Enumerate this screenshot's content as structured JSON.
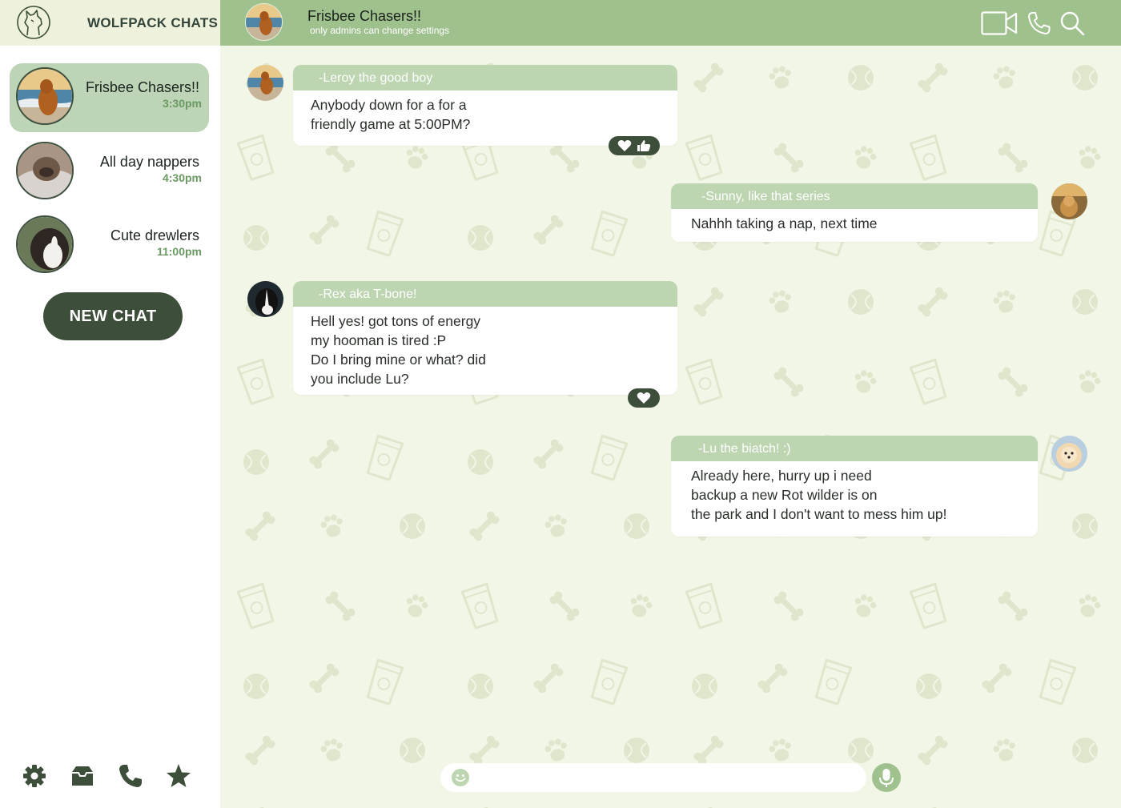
{
  "app": {
    "title": "WOLFPACK CHATS"
  },
  "chats": [
    {
      "name": "Frisbee Chasers!!",
      "time": "3:30pm",
      "active": true
    },
    {
      "name": "All day nappers",
      "time": "4:30pm",
      "active": false
    },
    {
      "name": "Cute drewlers",
      "time": "11:00pm",
      "active": false
    }
  ],
  "new_chat_label": "NEW CHAT",
  "bottom_nav": [
    "gear-icon",
    "inbox-icon",
    "phone-icon",
    "star-icon"
  ],
  "header": {
    "title": "Frisbee Chasers!!",
    "subtitle": "only admins can change settings",
    "icons": [
      "video-icon",
      "phone-icon",
      "search-icon"
    ]
  },
  "messages": [
    {
      "sender": "-Leroy the good boy",
      "side": "left",
      "lines": [
        "Anybody down for a for a",
        "friendly game at 5:00PM?"
      ],
      "reactions": [
        "heart-icon",
        "thumbs-up-icon"
      ]
    },
    {
      "sender": "-Sunny, like that series",
      "side": "right",
      "lines": [
        "Nahhh taking a nap, next time"
      ],
      "reactions": []
    },
    {
      "sender": "-Rex aka T-bone!",
      "side": "left",
      "lines": [
        "Hell yes! got tons of energy",
        "my hooman is tired :P",
        "Do I bring mine or what? did",
        "you include Lu?"
      ],
      "reactions": [
        "heart-icon"
      ]
    },
    {
      "sender": "-Lu the biatch! :)",
      "side": "right",
      "lines": [
        "Already here, hurry up i need",
        "backup a new Rot wilder is on",
        "the park and I don't want to mess him up!"
      ],
      "reactions": []
    }
  ],
  "composer": {
    "placeholder": ""
  },
  "colors": {
    "accent": "#9fc18e",
    "accent_light": "#bdd5b0",
    "dark": "#3d4f3a",
    "background": "#f2f6e6",
    "time": "#6a9a62"
  }
}
